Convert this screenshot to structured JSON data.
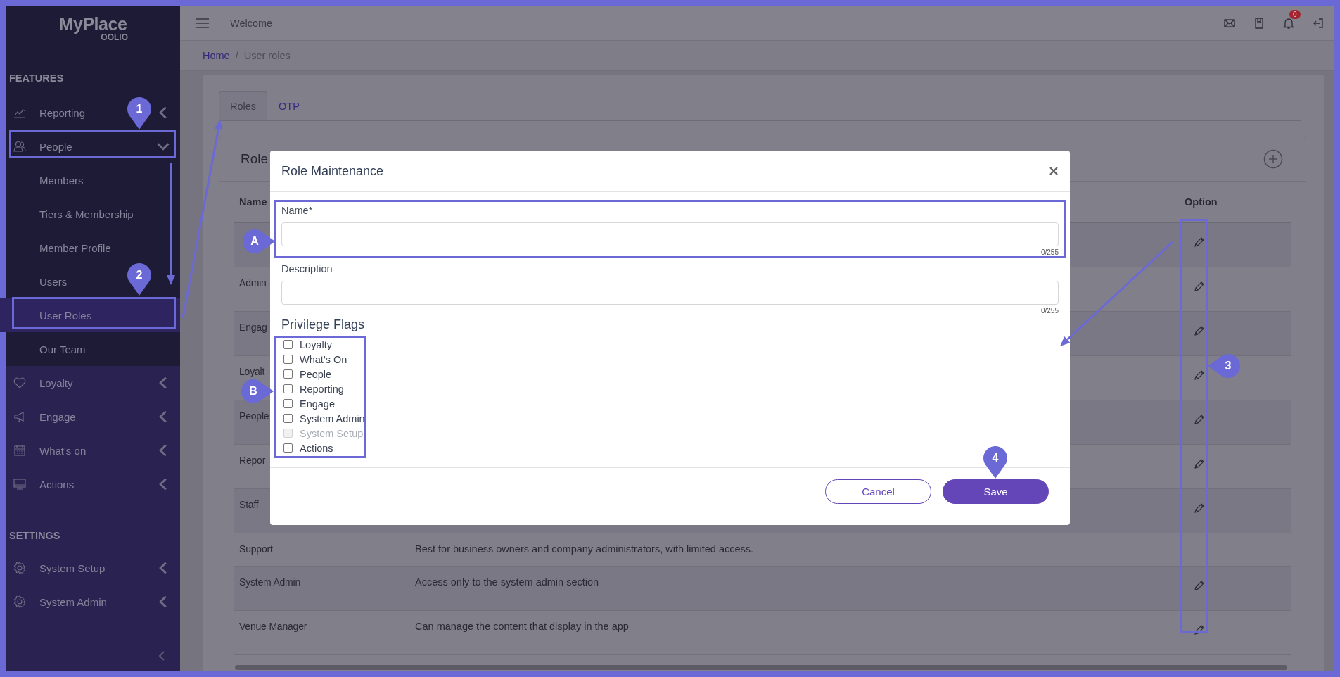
{
  "sidebar": {
    "logo": "MyPlace",
    "logo_sub": "OOLIO",
    "sections": [
      {
        "title": "FEATURES",
        "items": [
          {
            "label": "Reporting",
            "expanded": false,
            "selected": false
          },
          {
            "label": "People",
            "expanded": true,
            "selected": false,
            "children": [
              {
                "label": "Members",
                "selected": false
              },
              {
                "label": "Tiers & Membership",
                "selected": false
              },
              {
                "label": "Member Profile",
                "selected": false
              },
              {
                "label": "Users",
                "selected": false
              },
              {
                "label": "User Roles",
                "selected": true
              },
              {
                "label": "Our Team",
                "selected": false
              }
            ]
          },
          {
            "label": "Loyalty",
            "expanded": false,
            "selected": false
          },
          {
            "label": "Engage",
            "expanded": false,
            "selected": false
          },
          {
            "label": "What's on",
            "expanded": false,
            "selected": false
          },
          {
            "label": "Actions",
            "expanded": false,
            "selected": false
          }
        ]
      },
      {
        "title": "SETTINGS",
        "items": [
          {
            "label": "System Setup",
            "expanded": false,
            "selected": false
          },
          {
            "label": "System Admin",
            "expanded": false,
            "selected": false
          }
        ]
      }
    ]
  },
  "topbar": {
    "title": "Welcome",
    "notification_count": "0"
  },
  "breadcrumb": {
    "separator": "/",
    "items": [
      {
        "label": "Home",
        "kind": "link"
      },
      {
        "label": "User roles",
        "kind": "current"
      }
    ]
  },
  "tabs": [
    {
      "label": "Roles",
      "selected": true
    },
    {
      "label": "OTP",
      "selected": false
    }
  ],
  "roles_card": {
    "title": "Role",
    "table": {
      "columns": [
        "Name",
        "Option"
      ],
      "rows": [
        {
          "has_edit": true
        },
        {
          "name": "Admin",
          "has_edit": true
        },
        {
          "name": "Engag",
          "has_edit": true
        },
        {
          "name": "Loyalt",
          "has_edit": true
        },
        {
          "name": "People",
          "has_edit": true
        },
        {
          "name": "Repor",
          "has_edit": true
        },
        {
          "name": "Staff",
          "has_edit": true
        },
        {
          "name": "Support",
          "description": "Best for business owners and company administrators, with limited access.",
          "has_edit": false
        },
        {
          "name": "System Admin",
          "description": "Access only to the system admin section",
          "has_edit": true
        },
        {
          "name": "Venue Manager",
          "description": "Can manage the content that display in the app",
          "has_edit": true
        }
      ]
    }
  },
  "modal": {
    "title": "Role Maintenance",
    "fields": [
      {
        "label": "Name*",
        "counter": "0/255"
      },
      {
        "label": "Description",
        "counter": "0/255"
      }
    ],
    "flags_title": "Privilege Flags",
    "flags": [
      {
        "label": "Loyalty",
        "checked": false,
        "disabled": false
      },
      {
        "label": "What’s On",
        "checked": false,
        "disabled": false
      },
      {
        "label": "People",
        "checked": false,
        "disabled": false
      },
      {
        "label": "Reporting",
        "checked": false,
        "disabled": false
      },
      {
        "label": "Engage",
        "checked": false,
        "disabled": false
      },
      {
        "label": "System Admin",
        "checked": false,
        "disabled": false
      },
      {
        "label": "System Setup",
        "checked": false,
        "disabled": true
      },
      {
        "label": "Actions",
        "checked": false,
        "disabled": false
      }
    ],
    "buttons": [
      {
        "label": "Cancel",
        "kind": "secondary"
      },
      {
        "label": "Save",
        "kind": "primary"
      }
    ]
  },
  "callouts": [
    {
      "label": "1"
    },
    {
      "label": "2"
    },
    {
      "label": "A"
    },
    {
      "label": "B"
    },
    {
      "label": "3"
    },
    {
      "label": "4"
    }
  ]
}
